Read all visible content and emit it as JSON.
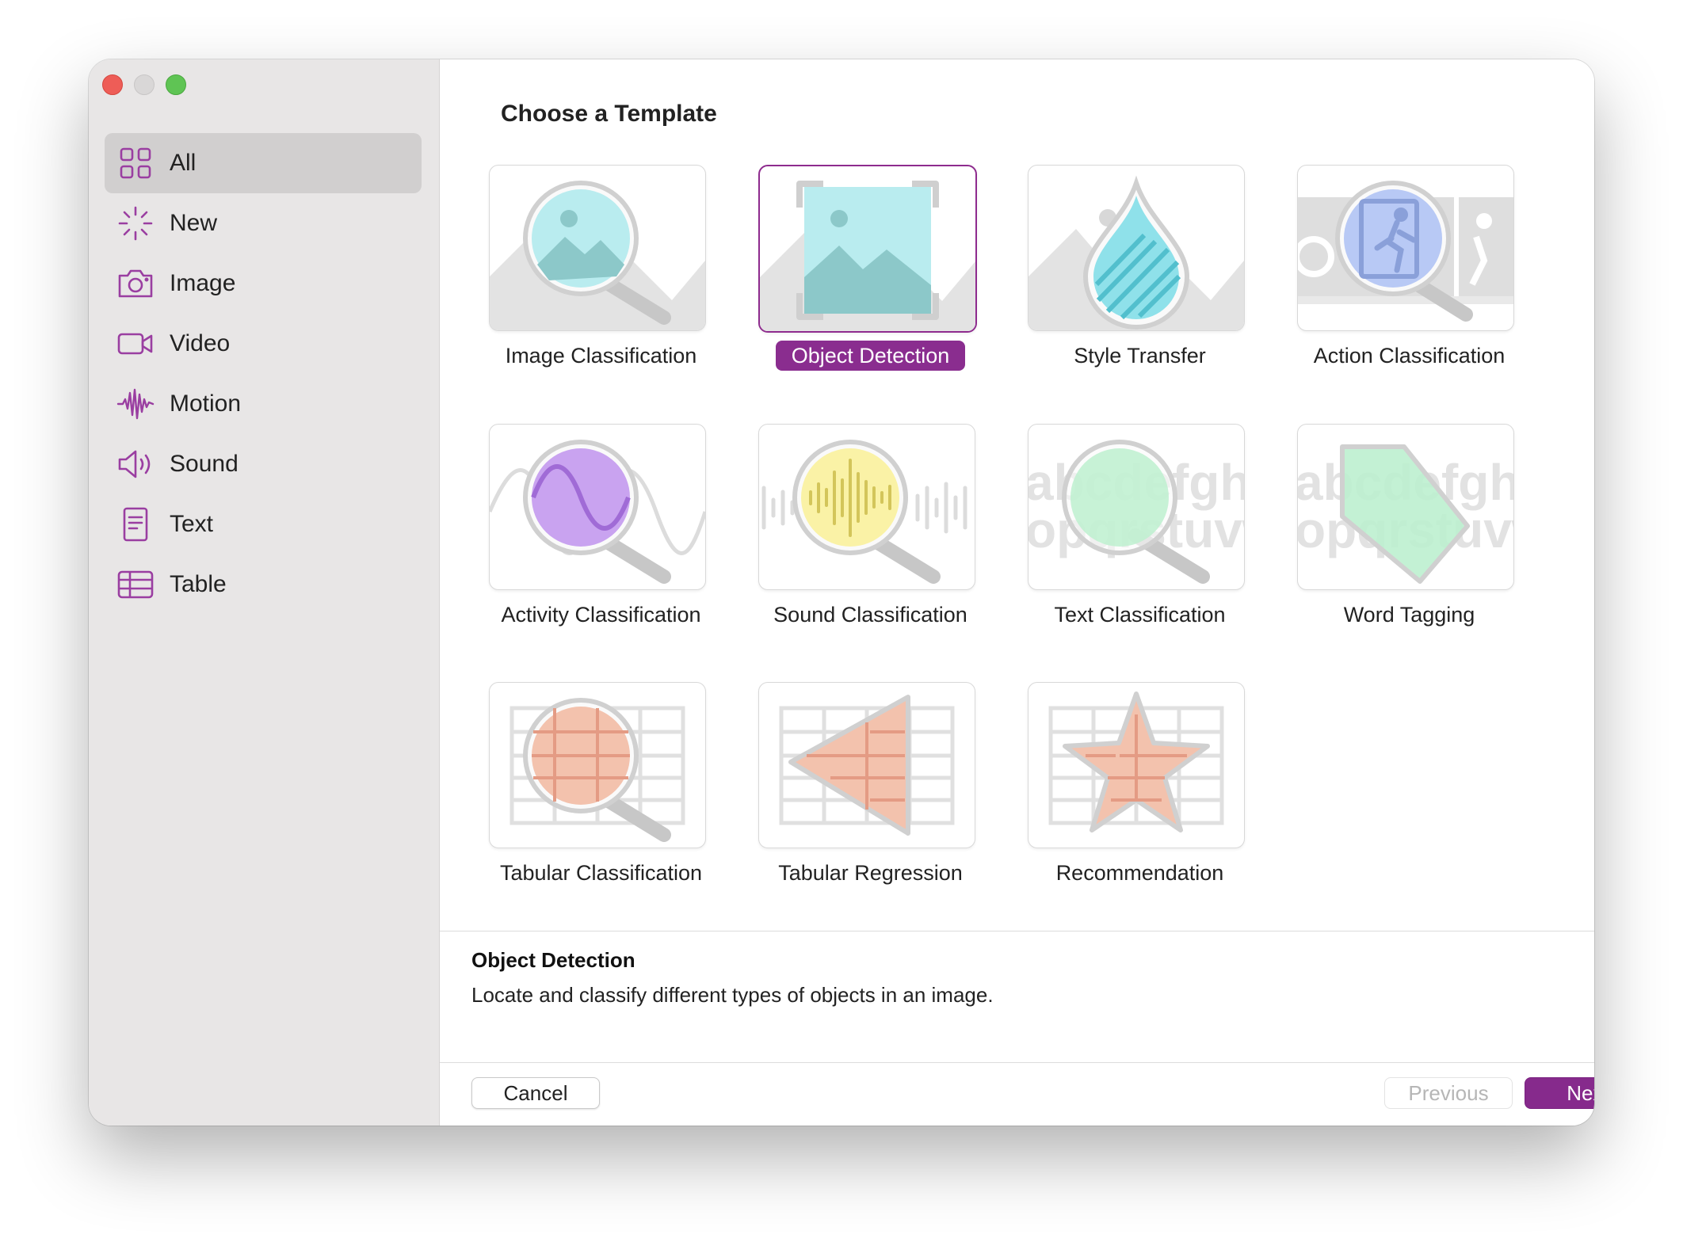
{
  "sidebar": {
    "items": [
      {
        "label": "All",
        "icon": "grid-icon",
        "selected": true
      },
      {
        "label": "New",
        "icon": "sparkle-icon"
      },
      {
        "label": "Image",
        "icon": "camera-icon"
      },
      {
        "label": "Video",
        "icon": "video-camera-icon"
      },
      {
        "label": "Motion",
        "icon": "waveform-icon"
      },
      {
        "label": "Sound",
        "icon": "speaker-icon"
      },
      {
        "label": "Text",
        "icon": "document-icon"
      },
      {
        "label": "Table",
        "icon": "table-icon"
      }
    ]
  },
  "main": {
    "heading": "Choose a Template",
    "templates": [
      {
        "label": "Image Classification",
        "icon": "image-magnifier-icon"
      },
      {
        "label": "Object Detection",
        "icon": "image-bracket-icon",
        "selected": true
      },
      {
        "label": "Style Transfer",
        "icon": "droplet-icon"
      },
      {
        "label": "Action Classification",
        "icon": "running-figure-magnifier-icon"
      },
      {
        "label": "Activity Classification",
        "icon": "sine-wave-magnifier-icon"
      },
      {
        "label": "Sound Classification",
        "icon": "audio-magnifier-icon"
      },
      {
        "label": "Text Classification",
        "icon": "text-magnifier-icon"
      },
      {
        "label": "Word Tagging",
        "icon": "tag-icon"
      },
      {
        "label": "Tabular Classification",
        "icon": "table-magnifier-icon"
      },
      {
        "label": "Tabular Regression",
        "icon": "table-triangle-icon"
      },
      {
        "label": "Recommendation",
        "icon": "table-star-icon"
      }
    ],
    "tile_glyphs": {
      "row1": "abcdefghi",
      "row2": "opqrstuvw"
    }
  },
  "description": {
    "title": "Object Detection",
    "text": "Locate and classify different types of objects in an image."
  },
  "footer": {
    "cancel_label": "Cancel",
    "previous_label": "Previous",
    "next_label": "Next"
  },
  "colors": {
    "accent": "#862a8c",
    "sidebar_icon": "#9a3ea1"
  }
}
